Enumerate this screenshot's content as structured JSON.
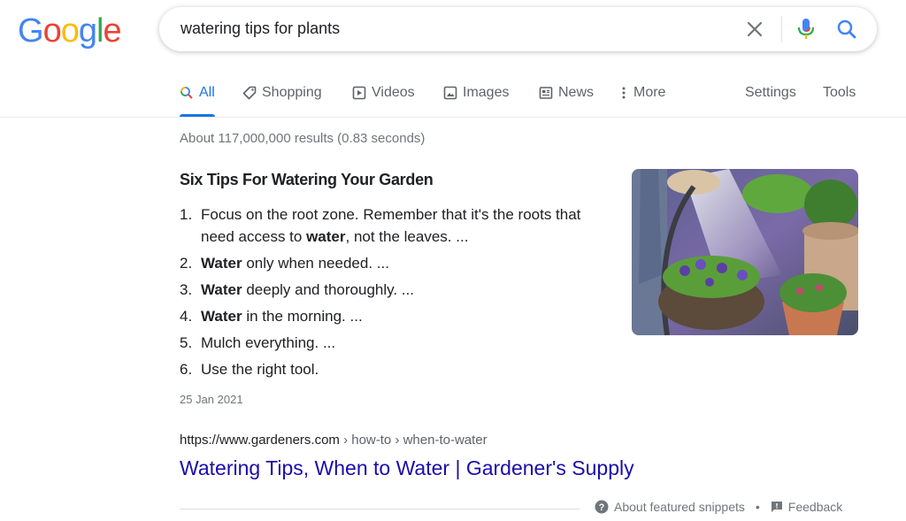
{
  "logo": {
    "letters": [
      "G",
      "o",
      "o",
      "g",
      "l",
      "e"
    ],
    "colors": [
      "#4285F4",
      "#EA4335",
      "#FBBC05",
      "#4285F4",
      "#34A853",
      "#EA4335"
    ]
  },
  "search": {
    "query": "watering tips for plants",
    "clear_icon": "close-icon",
    "mic_icon": "mic-icon",
    "search_icon": "search-icon"
  },
  "tabs": [
    {
      "label": "All",
      "icon": "search-icon"
    },
    {
      "label": "Shopping",
      "icon": "tag-icon"
    },
    {
      "label": "Videos",
      "icon": "play-icon"
    },
    {
      "label": "Images",
      "icon": "image-icon"
    },
    {
      "label": "News",
      "icon": "news-icon"
    },
    {
      "label": "More",
      "icon": "more-vert-icon"
    },
    {
      "label": "Settings"
    },
    {
      "label": "Tools"
    }
  ],
  "stats": "About 117,000,000 results (0.83 seconds)",
  "snippet": {
    "title": "Six Tips For Watering Your Garden",
    "items": [
      {
        "num": "1.",
        "pre": "Focus on the root zone. Remember that it's the roots that need access to ",
        "bold": "water",
        "post": ", not the leaves. ..."
      },
      {
        "num": "2.",
        "pre": "",
        "bold": "Water",
        "post": " only when needed. ..."
      },
      {
        "num": "3.",
        "pre": "",
        "bold": "Water",
        "post": " deeply and thoroughly. ..."
      },
      {
        "num": "4.",
        "pre": "",
        "bold": "Water",
        "post": " in the morning. ..."
      },
      {
        "num": "5.",
        "pre": "Mulch everything. ...",
        "bold": "",
        "post": ""
      },
      {
        "num": "6.",
        "pre": "Use the right tool.",
        "bold": "",
        "post": ""
      }
    ],
    "date": "25 Jan 2021",
    "image_description": "watering-plants-photo"
  },
  "result": {
    "domain": "https://www.gardeners.com",
    "path": " › how-to › when-to-water",
    "title": "Watering Tips, When to Water | Gardener's Supply"
  },
  "footer": {
    "about": "About featured snippets",
    "separator": "•",
    "feedback": "Feedback"
  },
  "colors": {
    "accent": "#1a73e8",
    "link": "#1a0dab",
    "muted": "#70757a"
  }
}
